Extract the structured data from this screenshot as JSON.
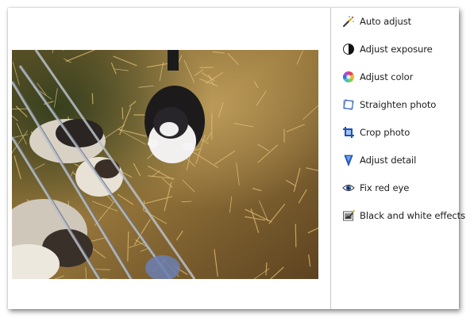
{
  "photo": {
    "subject": "cats-in-straw"
  },
  "edit_panel": {
    "items": [
      {
        "label": "Auto adjust",
        "icon": "magic-wand-icon"
      },
      {
        "label": "Adjust exposure",
        "icon": "exposure-icon"
      },
      {
        "label": "Adjust color",
        "icon": "color-wheel-icon"
      },
      {
        "label": "Straighten photo",
        "icon": "straighten-icon"
      },
      {
        "label": "Crop photo",
        "icon": "crop-icon"
      },
      {
        "label": "Adjust detail",
        "icon": "detail-triangle-icon"
      },
      {
        "label": "Fix red eye",
        "icon": "eye-icon"
      },
      {
        "label": "Black and white effects",
        "icon": "bw-effects-icon"
      }
    ]
  },
  "colors": {
    "panel_text": "#1e1e1e",
    "divider": "#c9c9c9",
    "straw": "#a07a3c"
  }
}
